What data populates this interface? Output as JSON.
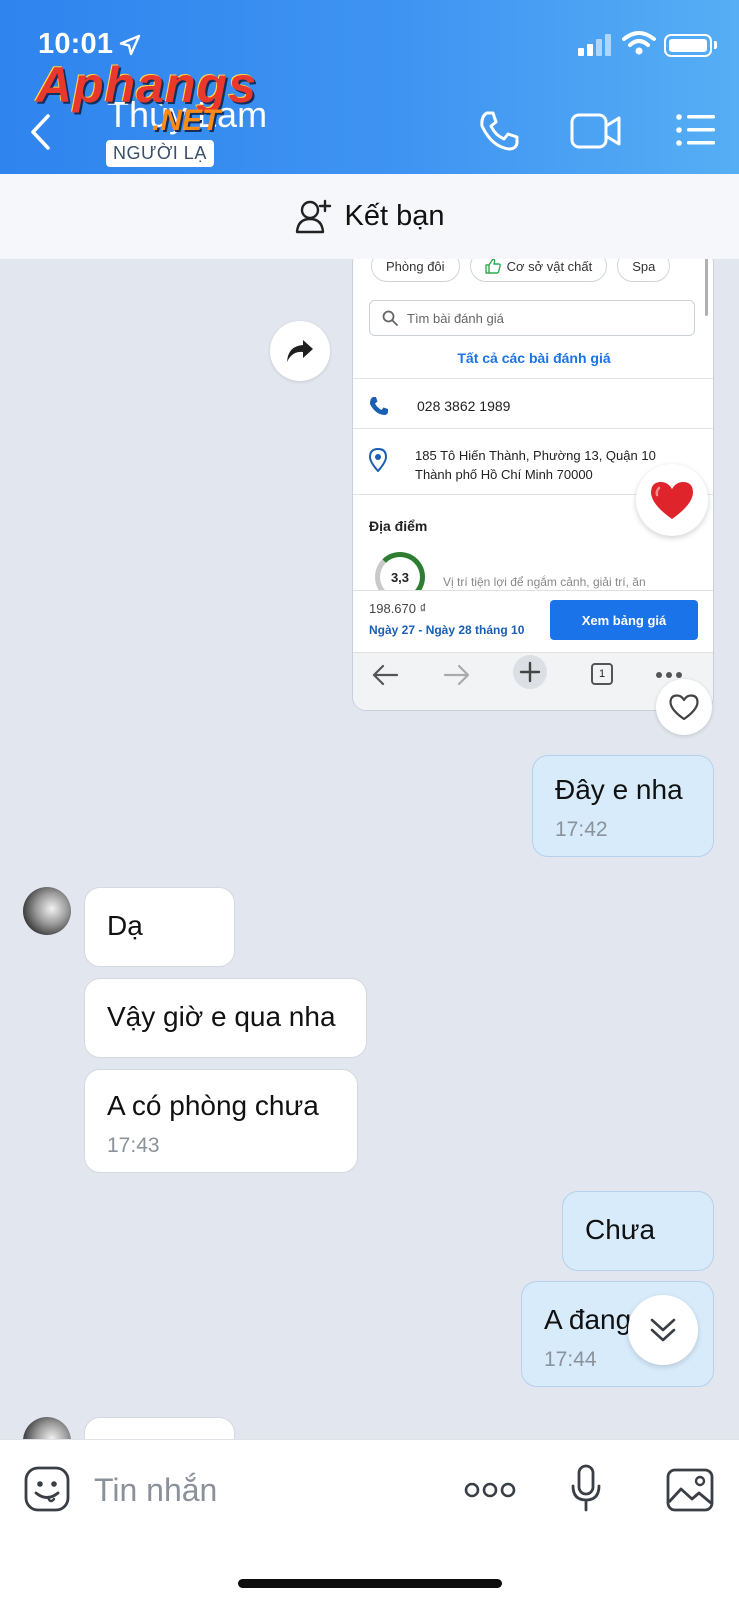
{
  "status_bar": {
    "time": "10:01"
  },
  "header": {
    "contact_name": "Thùy Lam",
    "stranger_badge": "NGƯỜI LẠ",
    "watermark_main": "Aphangs",
    "watermark_sub": ".NET"
  },
  "add_friend": {
    "label": "Kết bạn"
  },
  "shared_screenshot": {
    "chips": [
      "Phòng đôi",
      "Cơ sở vật chất",
      "Spa"
    ],
    "search_placeholder": "Tìm bài đánh giá",
    "all_reviews": "Tất cả các bài đánh giá",
    "phone": "028 3862 1989",
    "address_line1": "185 Tô Hiến Thành, Phường 13, Quận 10",
    "address_line2": "Thành phố Hồ Chí Minh 70000",
    "location_heading": "Địa điểm",
    "rating": "3,3",
    "faded_text": "Vị trí tiện lợi để ngắm cảnh, giải trí, ăn",
    "price": "198.670 ₫",
    "dates": "Ngày 27 - Ngày 28 tháng 10",
    "price_button": "Xem bảng giá",
    "tab_count": "1"
  },
  "messages": [
    {
      "side": "out",
      "text": "Đây e nha",
      "time": "17:42"
    },
    {
      "side": "in",
      "text": "Dạ"
    },
    {
      "side": "in",
      "text": "Vậy giờ e qua nha"
    },
    {
      "side": "in",
      "text": "A có phòng chưa",
      "time": "17:43"
    },
    {
      "side": "out",
      "text": "Chưa"
    },
    {
      "side": "out",
      "text": "A đang tới",
      "time": "17:44"
    }
  ],
  "composer": {
    "placeholder": "Tin nhắn"
  },
  "icons": {
    "back": "chevron-left-icon",
    "call": "phone-icon",
    "video": "video-camera-icon",
    "menu": "list-icon",
    "add_friend": "add-user-icon",
    "share": "share-arrow-icon",
    "reaction": "red-heart-icon",
    "like": "heart-outline-icon",
    "scroll_down": "double-chevron-down-icon",
    "sticker": "sticker-icon",
    "more": "more-dots-icon",
    "mic": "microphone-icon",
    "image": "image-icon"
  },
  "colors": {
    "header_gradient_start": "#2f84ee",
    "header_gradient_end": "#56aef4",
    "outgoing_bubble": "#d7ebfb",
    "incoming_bubble": "#ffffff",
    "chat_background": "#e2e6ee"
  }
}
